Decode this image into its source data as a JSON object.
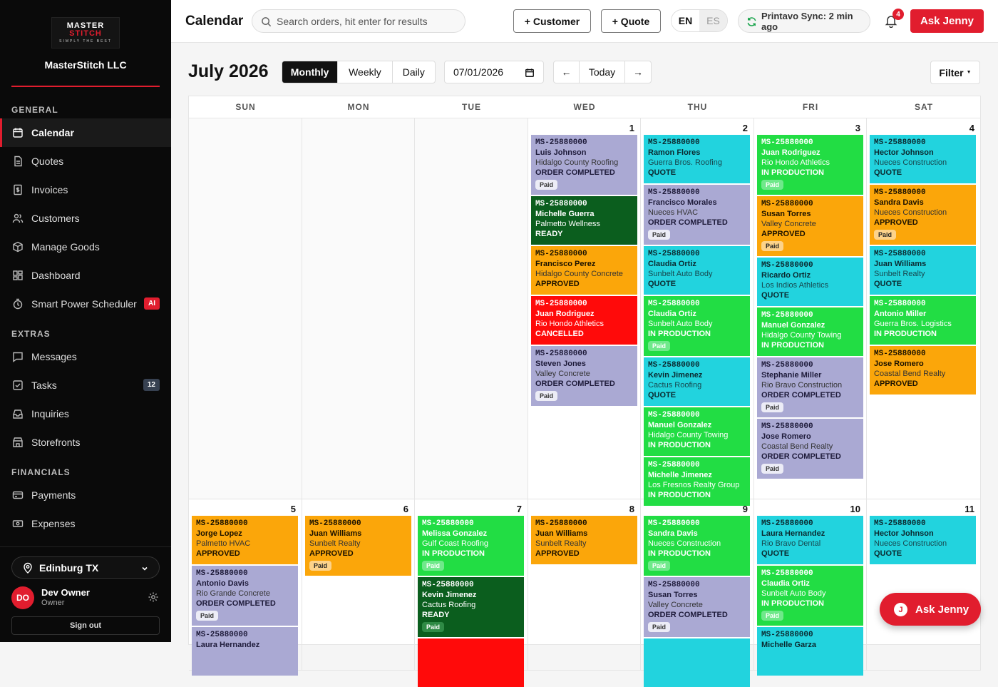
{
  "sidebar": {
    "logo": {
      "line1": "MASTER",
      "line2": "STITCH",
      "tagline": "SIMPLY THE BEST"
    },
    "company": "MasterStitch LLC",
    "sections": {
      "general": "GENERAL",
      "extras": "EXTRAS",
      "financials": "FINANCIALS"
    },
    "nav": {
      "calendar": "Calendar",
      "quotes": "Quotes",
      "invoices": "Invoices",
      "customers": "Customers",
      "goods": "Manage Goods",
      "dashboard": "Dashboard",
      "scheduler": "Smart Power Scheduler",
      "scheduler_badge": "AI",
      "messages": "Messages",
      "tasks": "Tasks",
      "tasks_count": "12",
      "inquiries": "Inquiries",
      "storefronts": "Storefronts",
      "payments": "Payments",
      "expenses": "Expenses"
    },
    "location": "Edinburg TX",
    "user": {
      "initials": "DO",
      "name": "Dev Owner",
      "role": "Owner"
    },
    "sign_out": "Sign out"
  },
  "topbar": {
    "title": "Calendar",
    "search_placeholder": "Search orders, hit enter for results",
    "customer_btn": "+ Customer",
    "quote_btn": "+ Quote",
    "lang_en": "EN",
    "lang_es": "ES",
    "sync": "Printavo Sync: 2 min ago",
    "notif_count": "4",
    "ask": "Ask Jenny"
  },
  "toolbar": {
    "month_title": "July 2026",
    "views": [
      "Monthly",
      "Weekly",
      "Daily"
    ],
    "active_view": "Monthly",
    "date": "07/01/2026",
    "today": "Today",
    "prev": "←",
    "next": "→",
    "filter": "Filter"
  },
  "calendar": {
    "weekdays": [
      "SUN",
      "MON",
      "TUE",
      "WED",
      "THU",
      "FRI",
      "SAT"
    ],
    "weeks": [
      [
        null,
        null,
        null,
        {
          "day": "1",
          "events": [
            {
              "order": "MS-25880000",
              "name": "Luis Johnson",
              "company": "Hidalgo County Roofing",
              "status": "ORDER COMPLETED",
              "paid": true,
              "kind": "completed"
            },
            {
              "order": "MS-25880000",
              "name": "Michelle Guerra",
              "company": "Palmetto Wellness",
              "status": "READY",
              "paid": false,
              "kind": "ready"
            },
            {
              "order": "MS-25880000",
              "name": "Francisco Perez",
              "company": "Hidalgo County Concrete",
              "status": "APPROVED",
              "paid": false,
              "kind": "approved"
            },
            {
              "order": "MS-25880000",
              "name": "Juan Rodriguez",
              "company": "Rio Hondo Athletics",
              "status": "CANCELLED",
              "paid": false,
              "kind": "cancelled"
            },
            {
              "order": "MS-25880000",
              "name": "Steven Jones",
              "company": "Valley Concrete",
              "status": "ORDER COMPLETED",
              "paid": true,
              "kind": "completed"
            }
          ]
        },
        {
          "day": "2",
          "events": [
            {
              "order": "MS-25880000",
              "name": "Ramon Flores",
              "company": "Guerra Bros. Roofing",
              "status": "QUOTE",
              "paid": false,
              "kind": "quote"
            },
            {
              "order": "MS-25880000",
              "name": "Francisco Morales",
              "company": "Nueces HVAC",
              "status": "ORDER COMPLETED",
              "paid": true,
              "kind": "completed"
            },
            {
              "order": "MS-25880000",
              "name": "Claudia Ortiz",
              "company": "Sunbelt Auto Body",
              "status": "QUOTE",
              "paid": false,
              "kind": "quote"
            },
            {
              "order": "MS-25880000",
              "name": "Claudia Ortiz",
              "company": "Sunbelt Auto Body",
              "status": "IN PRODUCTION",
              "paid": true,
              "kind": "prod"
            },
            {
              "order": "MS-25880000",
              "name": "Kevin Jimenez",
              "company": "Cactus Roofing",
              "status": "QUOTE",
              "paid": false,
              "kind": "quote"
            },
            {
              "order": "MS-25880000",
              "name": "Manuel Gonzalez",
              "company": "Hidalgo County Towing",
              "status": "IN PRODUCTION",
              "paid": false,
              "kind": "prod"
            },
            {
              "order": "MS-25880000",
              "name": "Michelle Jimenez",
              "company": "Los Fresnos Realty Group",
              "status": "IN PRODUCTION",
              "paid": false,
              "kind": "prod"
            }
          ]
        },
        {
          "day": "3",
          "events": [
            {
              "order": "MS-25880000",
              "name": "Juan Rodriguez",
              "company": "Rio Hondo Athletics",
              "status": "IN PRODUCTION",
              "paid": true,
              "kind": "prod"
            },
            {
              "order": "MS-25880000",
              "name": "Susan Torres",
              "company": "Valley Concrete",
              "status": "APPROVED",
              "paid": true,
              "kind": "approved"
            },
            {
              "order": "MS-25880000",
              "name": "Ricardo Ortiz",
              "company": "Los Indios Athletics",
              "status": "QUOTE",
              "paid": false,
              "kind": "quote"
            },
            {
              "order": "MS-25880000",
              "name": "Manuel Gonzalez",
              "company": "Hidalgo County Towing",
              "status": "IN PRODUCTION",
              "paid": false,
              "kind": "prod"
            },
            {
              "order": "MS-25880000",
              "name": "Stephanie Miller",
              "company": "Rio Bravo Construction",
              "status": "ORDER COMPLETED",
              "paid": true,
              "kind": "completed"
            },
            {
              "order": "MS-25880000",
              "name": "Jose Romero",
              "company": "Coastal Bend Realty",
              "status": "ORDER COMPLETED",
              "paid": true,
              "kind": "completed"
            }
          ]
        },
        {
          "day": "4",
          "events": [
            {
              "order": "MS-25880000",
              "name": "Hector Johnson",
              "company": "Nueces Construction",
              "status": "QUOTE",
              "paid": false,
              "kind": "quote"
            },
            {
              "order": "MS-25880000",
              "name": "Sandra Davis",
              "company": "Nueces Construction",
              "status": "APPROVED",
              "paid": true,
              "kind": "approved"
            },
            {
              "order": "MS-25880000",
              "name": "Juan Williams",
              "company": "Sunbelt Realty",
              "status": "QUOTE",
              "paid": false,
              "kind": "quote"
            },
            {
              "order": "MS-25880000",
              "name": "Antonio Miller",
              "company": "Guerra Bros. Logistics",
              "status": "IN PRODUCTION",
              "paid": false,
              "kind": "prod"
            },
            {
              "order": "MS-25880000",
              "name": "Jose Romero",
              "company": "Coastal Bend Realty",
              "status": "APPROVED",
              "paid": false,
              "kind": "approved"
            }
          ]
        }
      ],
      [
        {
          "day": "5",
          "events": [
            {
              "order": "MS-25880000",
              "name": "Jorge Lopez",
              "company": "Palmetto HVAC",
              "status": "APPROVED",
              "paid": false,
              "kind": "approved"
            },
            {
              "order": "MS-25880000",
              "name": "Antonio Davis",
              "company": "Rio Grande Concrete",
              "status": "ORDER COMPLETED",
              "paid": true,
              "kind": "completed"
            },
            {
              "order": "MS-25880000",
              "name": "Laura Hernandez",
              "company": "",
              "status": "",
              "paid": false,
              "kind": "completed"
            }
          ]
        },
        {
          "day": "6",
          "events": [
            {
              "order": "MS-25880000",
              "name": "Juan Williams",
              "company": "Sunbelt Realty",
              "status": "APPROVED",
              "paid": true,
              "kind": "approved"
            }
          ]
        },
        {
          "day": "7",
          "events": [
            {
              "order": "MS-25880000",
              "name": "Melissa Gonzalez",
              "company": "Gulf Coast Roofing",
              "status": "IN PRODUCTION",
              "paid": true,
              "kind": "prod"
            },
            {
              "order": "MS-25880000",
              "name": "Kevin Jimenez",
              "company": "Cactus Roofing",
              "status": "READY",
              "paid": true,
              "kind": "ready"
            },
            {
              "order": "",
              "name": "",
              "company": "",
              "status": "",
              "paid": false,
              "kind": "cancelled"
            }
          ]
        },
        {
          "day": "8",
          "events": [
            {
              "order": "MS-25880000",
              "name": "Juan Williams",
              "company": "Sunbelt Realty",
              "status": "APPROVED",
              "paid": false,
              "kind": "approved"
            }
          ]
        },
        {
          "day": "9",
          "events": [
            {
              "order": "MS-25880000",
              "name": "Sandra Davis",
              "company": "Nueces Construction",
              "status": "IN PRODUCTION",
              "paid": true,
              "kind": "prod"
            },
            {
              "order": "MS-25880000",
              "name": "Susan Torres",
              "company": "Valley Concrete",
              "status": "ORDER COMPLETED",
              "paid": true,
              "kind": "completed"
            },
            {
              "order": "",
              "name": "",
              "company": "",
              "status": "",
              "paid": false,
              "kind": "quote"
            }
          ]
        },
        {
          "day": "10",
          "events": [
            {
              "order": "MS-25880000",
              "name": "Laura Hernandez",
              "company": "Rio Bravo Dental",
              "status": "QUOTE",
              "paid": false,
              "kind": "quote"
            },
            {
              "order": "MS-25880000",
              "name": "Claudia Ortiz",
              "company": "Sunbelt Auto Body",
              "status": "IN PRODUCTION",
              "paid": true,
              "kind": "prod"
            },
            {
              "order": "MS-25880000",
              "name": "Michelle Garza",
              "company": "",
              "status": "",
              "paid": false,
              "kind": "quote"
            }
          ]
        },
        {
          "day": "11",
          "events": [
            {
              "order": "MS-25880000",
              "name": "Hector Johnson",
              "company": "Nueces Construction",
              "status": "QUOTE",
              "paid": false,
              "kind": "quote"
            }
          ]
        }
      ]
    ],
    "paid_label": "Paid"
  },
  "fab": {
    "initial": "J",
    "label": "Ask Jenny"
  },
  "colors": {
    "accent": "#e11d2e",
    "completed": "#aaa9d3",
    "ready": "#0b5e1e",
    "approved": "#fba60a",
    "cancelled": "#ff0a0a",
    "quote": "#22d3de",
    "in_production": "#22dd44"
  }
}
